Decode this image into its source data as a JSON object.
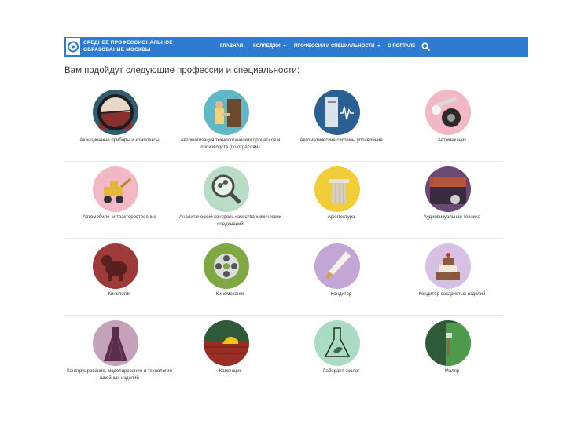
{
  "header": {
    "logo_line1": "СРЕДНЕЕ ПРОФЕССИОНАЛЬНОЕ",
    "logo_line2": "ОБРАЗОВАНИЕ МОСКВЫ",
    "nav": [
      {
        "label": "ГЛАВНАЯ",
        "has_caret": false
      },
      {
        "label": "КОЛЛЕДЖИ",
        "has_caret": true
      },
      {
        "label": "ПРОФЕССИИ И СПЕЦИАЛЬНОСТИ",
        "has_caret": true
      },
      {
        "label": "О ПОРТАЛЕ",
        "has_caret": false
      }
    ],
    "search_icon": "search-icon",
    "bar_color": "#2f7bd1"
  },
  "page": {
    "heading": "Вам подойдут следующие профессии и специальности:"
  },
  "professions": [
    {
      "label": "Авиационные приборы и комплексы",
      "color": "#2f5e73",
      "icon": "aviation-instrument-icon"
    },
    {
      "label": "Автоматизация технологических процессов и производств (по отраслям)",
      "color": "#5fb7c8",
      "icon": "technician-icon"
    },
    {
      "label": "Автоматические системы управления",
      "color": "#2c5f92",
      "icon": "control-system-icon"
    },
    {
      "label": "Автомеханик",
      "color": "#f2b8c6",
      "icon": "wrench-tire-icon"
    },
    {
      "label": "Автомобиле- и тракторостроение",
      "color": "#f2b8c6",
      "icon": "excavator-icon"
    },
    {
      "label": "Аналитический контроль качества химических соединений",
      "color": "#b9dcc6",
      "icon": "magnifier-molecule-icon"
    },
    {
      "label": "Архитектура",
      "color": "#f2cd3a",
      "icon": "column-icon"
    },
    {
      "label": "Аудиовизуальная техника",
      "color": "#6a4a74",
      "icon": "stage-icon"
    },
    {
      "label": "Кинология",
      "color": "#9e3a3a",
      "icon": "dog-icon"
    },
    {
      "label": "Киномеханик",
      "color": "#7fa843",
      "icon": "film-reel-icon"
    },
    {
      "label": "Кондитер",
      "color": "#c1a6d6",
      "icon": "pastry-bag-icon"
    },
    {
      "label": "Кондитер сахаристых изделий",
      "color": "#d6c1e4",
      "icon": "cake-icon"
    },
    {
      "label": "Конструирование, моделирование и технология швейных изделий",
      "color": "#c6a2ba",
      "icon": "dress-icon"
    },
    {
      "label": "Каменщик",
      "color": "#2e5a3a",
      "icon": "brick-helmet-icon"
    },
    {
      "label": "Лаборант-эколог",
      "color": "#aadbc3",
      "icon": "flask-leaf-icon"
    },
    {
      "label": "Маляр",
      "color": "#2f5a3a",
      "icon": "paint-roller-icon"
    }
  ]
}
